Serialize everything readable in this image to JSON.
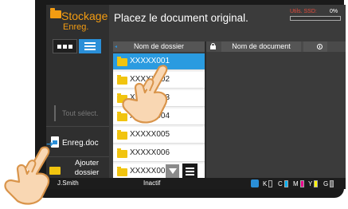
{
  "app": {
    "title": "Stockage",
    "subtitle": "Enreg."
  },
  "header": {
    "message": "Placez le document original."
  },
  "storage": {
    "label": "Utils. SSD:",
    "value": "0%",
    "fill_fraction": 0.0
  },
  "table": {
    "col_folder": "Nom de dossier",
    "col_document": "Nom de document"
  },
  "folders": [
    {
      "name": "XXXXX001",
      "selected": true
    },
    {
      "name": "XXXXX002",
      "selected": false
    },
    {
      "name": "XXXXX003",
      "selected": false
    },
    {
      "name": "XXXXX004",
      "selected": false
    },
    {
      "name": "XXXXX005",
      "selected": false
    },
    {
      "name": "XXXXX006",
      "selected": false
    },
    {
      "name": "XXXXX007",
      "selected": false
    }
  ],
  "sidebar": {
    "select_all": "Tout sélect.",
    "store_doc": "Enreg.doc",
    "add_folder_line1": "Ajouter",
    "add_folder_line2": "dossier"
  },
  "status": {
    "user": "J.Smith",
    "state": "Inactif",
    "toners": [
      {
        "letter": "K",
        "color": "#222222"
      },
      {
        "letter": "C",
        "color": "#00aeef"
      },
      {
        "letter": "M",
        "color": "#ec008c"
      },
      {
        "letter": "Y",
        "color": "#fff200"
      },
      {
        "letter": "G",
        "color": "#777777"
      }
    ]
  },
  "colors": {
    "accent": "#2a9be0",
    "brand": "#f39c12",
    "folder": "#f1c40f"
  }
}
